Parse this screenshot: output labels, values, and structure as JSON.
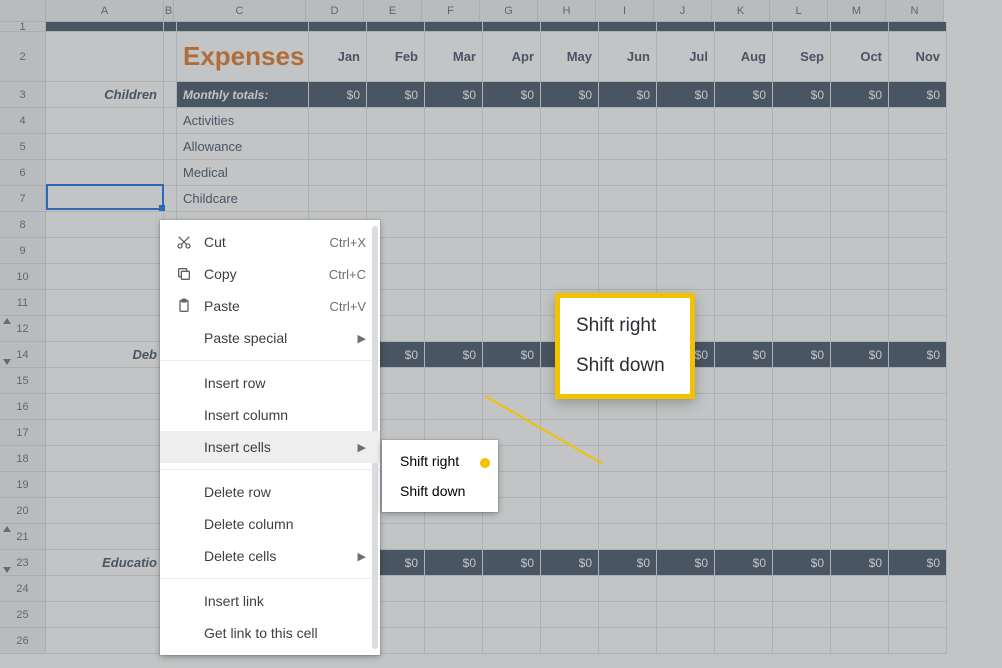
{
  "columns": [
    {
      "l": "A",
      "w": 118
    },
    {
      "l": "B",
      "w": 10
    },
    {
      "l": "C",
      "w": 132
    },
    {
      "l": "D",
      "w": 58
    },
    {
      "l": "E",
      "w": 58
    },
    {
      "l": "F",
      "w": 58
    },
    {
      "l": "G",
      "w": 58
    },
    {
      "l": "H",
      "w": 58
    },
    {
      "l": "I",
      "w": 58
    },
    {
      "l": "J",
      "w": 58
    },
    {
      "l": "K",
      "w": 58
    },
    {
      "l": "L",
      "w": 58
    },
    {
      "l": "M",
      "w": 58
    },
    {
      "l": "N",
      "w": 58
    }
  ],
  "rows": [
    {
      "n": "1",
      "h": 10
    },
    {
      "n": "2",
      "h": 50
    },
    {
      "n": "3",
      "h": 26
    },
    {
      "n": "4",
      "h": 26
    },
    {
      "n": "5",
      "h": 26
    },
    {
      "n": "6",
      "h": 26
    },
    {
      "n": "7",
      "h": 26
    },
    {
      "n": "8",
      "h": 26
    },
    {
      "n": "9",
      "h": 26
    },
    {
      "n": "10",
      "h": 26
    },
    {
      "n": "11",
      "h": 26
    },
    {
      "n": "12",
      "h": 26,
      "up": true
    },
    {
      "n": "14",
      "h": 26,
      "dn": true
    },
    {
      "n": "15",
      "h": 26
    },
    {
      "n": "16",
      "h": 26
    },
    {
      "n": "17",
      "h": 26
    },
    {
      "n": "18",
      "h": 26
    },
    {
      "n": "19",
      "h": 26
    },
    {
      "n": "20",
      "h": 26
    },
    {
      "n": "21",
      "h": 26,
      "up": true
    },
    {
      "n": "23",
      "h": 26,
      "dn": true
    },
    {
      "n": "24",
      "h": 26
    },
    {
      "n": "25",
      "h": 26
    },
    {
      "n": "26",
      "h": 26
    }
  ],
  "title": "Expenses",
  "months": [
    "Jan",
    "Feb",
    "Mar",
    "Apr",
    "May",
    "Jun",
    "Jul",
    "Aug",
    "Sep",
    "Oct",
    "Nov"
  ],
  "section_children": "Children",
  "section_deb": "Deb",
  "section_edu": "Educatio",
  "monthly_totals": "Monthly totals:",
  "zero": "$0",
  "cats": [
    "Activities",
    "Allowance",
    "Medical",
    "Childcare"
  ],
  "menu": {
    "cut": "Cut",
    "copy": "Copy",
    "paste": "Paste",
    "paste_special": "Paste special",
    "insert_row": "Insert row",
    "insert_column": "Insert column",
    "insert_cells": "Insert cells",
    "delete_row": "Delete row",
    "delete_column": "Delete column",
    "delete_cells": "Delete cells",
    "insert_link": "Insert link",
    "get_link": "Get link to this cell",
    "sc_cut": "Ctrl+X",
    "sc_copy": "Ctrl+C",
    "sc_paste": "Ctrl+V"
  },
  "submenu": {
    "shift_right": "Shift right",
    "shift_down": "Shift down"
  },
  "callout": {
    "shift_right": "Shift right",
    "shift_down": "Shift down"
  }
}
